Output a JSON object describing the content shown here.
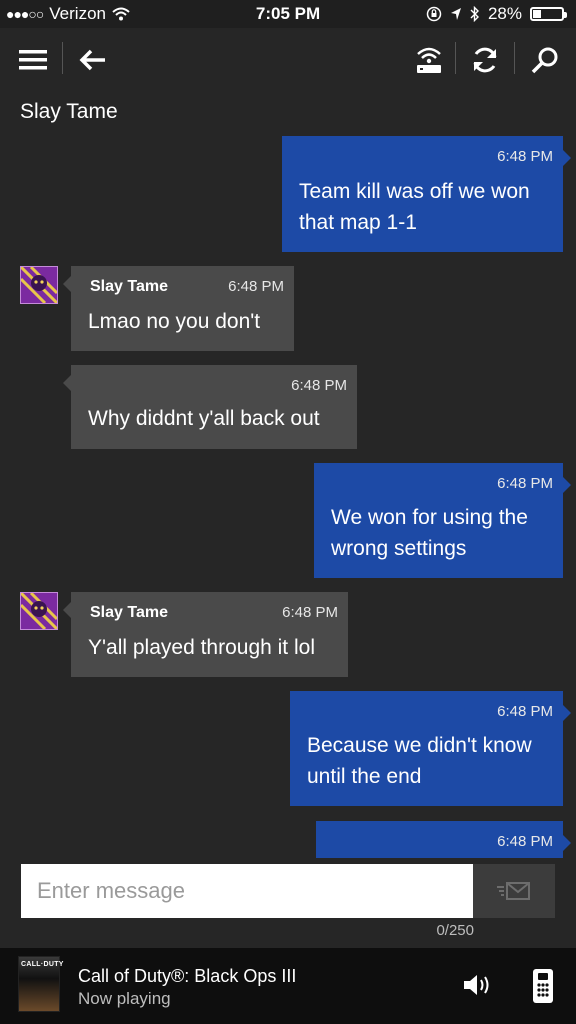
{
  "status_bar": {
    "carrier": "Verizon",
    "time": "7:05 PM",
    "battery": "28%",
    "battery_level": 0.28
  },
  "app_bar": {
    "icons": [
      "menu-icon",
      "back-arrow-icon",
      "wifi-router-icon",
      "refresh-icon",
      "search-icon"
    ]
  },
  "conversation": {
    "title": "Slay Tame"
  },
  "messages": [
    {
      "direction": "out",
      "time": "6:48 PM",
      "text_lines": [
        "Team kill was off we won",
        "that map 1-1"
      ]
    },
    {
      "direction": "in",
      "sender": "Slay Tame",
      "time": "6:48 PM",
      "text_lines": [
        "Lmao no you don't"
      ]
    },
    {
      "direction": "in",
      "time": "6:48 PM",
      "text_lines": [
        "Why diddnt y'all back out"
      ]
    },
    {
      "direction": "out",
      "time": "6:48 PM",
      "text_lines": [
        "We won for using the",
        "wrong settings"
      ]
    },
    {
      "direction": "in",
      "sender": "Slay Tame",
      "time": "6:48 PM",
      "text_lines": [
        "Y'all played through it lol"
      ]
    },
    {
      "direction": "out",
      "time": "6:48 PM",
      "text_lines": [
        "Because we didn't know",
        "until the end"
      ]
    },
    {
      "direction": "out",
      "time": "6:48 PM",
      "text_lines": []
    }
  ],
  "composer": {
    "placeholder": "Enter message",
    "value": "",
    "counter": "0/250"
  },
  "now_playing": {
    "title": "Call of Duty®: Black Ops III",
    "subtitle": "Now playing",
    "art_label": "CALL·DUTY"
  },
  "colors": {
    "outgoing_bubble": "#1d4aa6",
    "incoming_bubble": "#4a4a4a",
    "background": "#262626"
  }
}
